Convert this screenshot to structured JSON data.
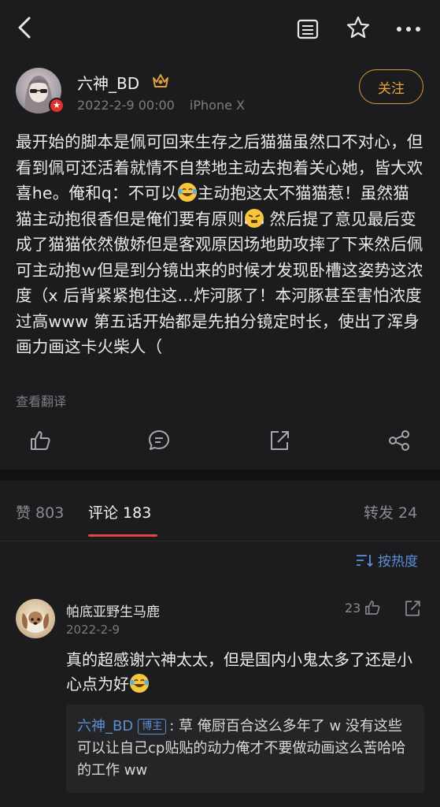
{
  "topbar": {
    "icons": [
      "back-icon",
      "reader-icon",
      "star-icon",
      "more-icon"
    ]
  },
  "post": {
    "author": "六神_BD",
    "date": "2022-2-9 00:00",
    "device": "iPhone X",
    "follow_label": "关注",
    "text_1": "最开始的脚本是佩可回来生存之后猫猫虽然口不对心，但看到佩可还活着就情不自禁地主动去抱着关心她，皆大欢喜he。俺和q：不可以",
    "text_2": "主动抱这太不猫猫惹！虽然猫猫主动抱很香但是俺们要有原则",
    "text_3": " 然后提了意见最后变成了猫猫依然傲娇但是客观原因场地助攻摔了下来然后佩可主动抱ｗ但是到分镜出来的时候才发现卧槽这姿势这浓度（x 后背紧紧抱住这…炸河豚了！本河豚甚至害怕浓度过高www 第五话开始都是先拍分镜定时长，使出了浑身画力画这卡火柴人（",
    "translate_label": "查看翻译"
  },
  "tabs": {
    "likes": "赞 803",
    "comments": "评论 183",
    "reposts": "转发 24"
  },
  "sort_label": "按热度",
  "comment": {
    "author": "帕底亚野生马鹿",
    "date": "2022-2-9",
    "likes": "23",
    "text": "真的超感谢六神太太，但是国内小鬼太多了还是小心点为好",
    "reply_author": "六神_BD",
    "reply_tag": "博主",
    "reply_text": ": 草 俺厨百合这么多年了 w 没有这些可以让自己cp贴贴的动力俺才不要做动画这么苦哈哈的工作 ww"
  },
  "colors": {
    "background": "#1c1c1e",
    "follow_accent": "#e8a43a",
    "link_blue": "#5b8fd6",
    "tab_underline": "#e0463f"
  }
}
